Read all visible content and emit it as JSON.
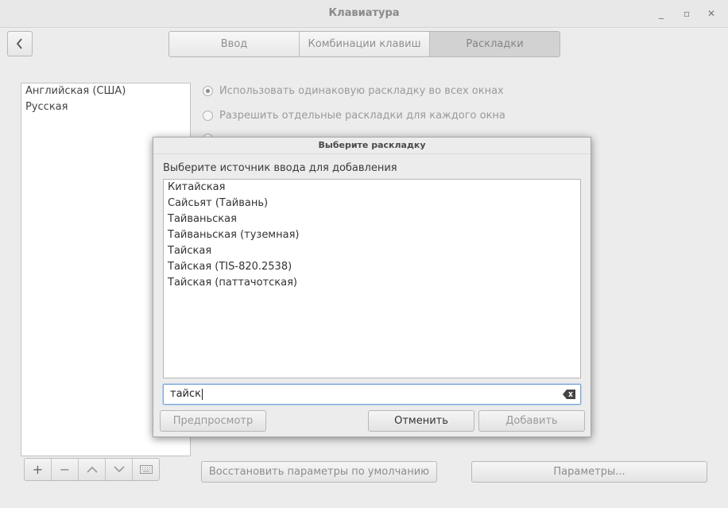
{
  "window": {
    "title": "Клавиатура"
  },
  "tabs": [
    {
      "label": "Ввод"
    },
    {
      "label": "Комбинации клавиш"
    },
    {
      "label": "Раскладки"
    }
  ],
  "layouts": {
    "items": [
      {
        "label": "Английская (США)"
      },
      {
        "label": "Русская"
      }
    ]
  },
  "options": {
    "same_layout": "Использовать одинаковую раскладку во всех окнах",
    "separate_layout": "Разрешить отдельные раскладки для каждого окна"
  },
  "toolbar": {
    "add_label": "+",
    "remove_label": "−",
    "up_label": "︿",
    "down_label": "﹀"
  },
  "buttons": {
    "restore_defaults": "Восстановить параметры по умолчанию",
    "parameters": "Параметры..."
  },
  "dialog": {
    "title": "Выберите раскладку",
    "prompt": "Выберите источник ввода для добавления",
    "sources": [
      {
        "label": "Китайская"
      },
      {
        "label": "Сайсьят (Тайвань)"
      },
      {
        "label": "Тайваньская"
      },
      {
        "label": "Тайваньская (туземная)"
      },
      {
        "label": "Тайская"
      },
      {
        "label": "Тайская (TIS-820.2538)"
      },
      {
        "label": "Тайская (паттачотская)"
      }
    ],
    "search_value": "тайск",
    "preview_label": "Предпросмотр",
    "cancel_label": "Отменить",
    "add_label": "Добавить"
  }
}
